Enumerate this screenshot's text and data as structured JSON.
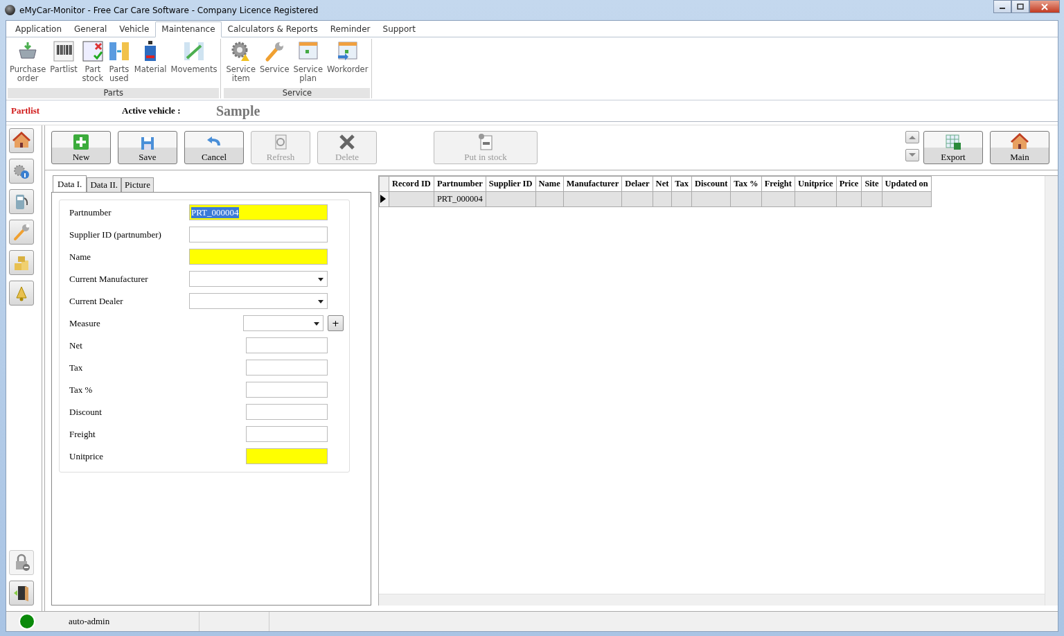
{
  "window": {
    "title": "eMyCar-Monitor - Free Car Care Software - Company Licence Registered"
  },
  "menu_tabs": [
    {
      "label": "Application",
      "selected": false
    },
    {
      "label": "General",
      "selected": false
    },
    {
      "label": "Vehicle",
      "selected": false
    },
    {
      "label": "Maintenance",
      "selected": true
    },
    {
      "label": "Calculators & Reports",
      "selected": false
    },
    {
      "label": "Reminder",
      "selected": false
    },
    {
      "label": "Support",
      "selected": false
    }
  ],
  "ribbon": {
    "groups": [
      {
        "label": "Parts",
        "items": [
          {
            "label": "Purchase\norder"
          },
          {
            "label": "Partlist"
          },
          {
            "label": "Part\nstock"
          },
          {
            "label": "Parts\nused"
          },
          {
            "label": "Material"
          },
          {
            "label": "Movements"
          }
        ]
      },
      {
        "label": "Service",
        "items": [
          {
            "label": "Service\nitem"
          },
          {
            "label": "Service"
          },
          {
            "label": "Service\nplan"
          },
          {
            "label": "Workorder"
          }
        ]
      }
    ]
  },
  "header": {
    "module": "Partlist",
    "active_vehicle_label": "Active vehicle :",
    "vehicle": "Sample"
  },
  "toolbar": {
    "buttons": [
      {
        "label": "New",
        "disabled": false
      },
      {
        "label": "Save",
        "disabled": false
      },
      {
        "label": "Cancel",
        "disabled": false
      },
      {
        "label": "Refresh",
        "disabled": true
      },
      {
        "label": "Delete",
        "disabled": true
      }
    ],
    "stock_button": {
      "label": "Put in stock",
      "disabled": true
    },
    "right_buttons": [
      {
        "label": "Export",
        "disabled": false
      },
      {
        "label": "Main",
        "disabled": false
      }
    ]
  },
  "form": {
    "tabs": [
      {
        "label": "Data I.",
        "selected": true
      },
      {
        "label": "Data II.",
        "selected": false
      },
      {
        "label": "Picture",
        "selected": false
      }
    ],
    "fields": [
      {
        "label": "Partnumber",
        "kind": "text",
        "required": true,
        "value": "PRT_000004",
        "text_selected": true
      },
      {
        "label": "Supplier ID (partnumber)",
        "kind": "text",
        "required": false
      },
      {
        "label": "Name",
        "kind": "text",
        "required": true
      },
      {
        "label": "Current Manufacturer",
        "kind": "combo",
        "required": false
      },
      {
        "label": "Current Dealer",
        "kind": "combo",
        "required": false
      },
      {
        "label": "Measure",
        "kind": "unit-combo",
        "required": false,
        "add_button": "+"
      },
      {
        "label": "Net",
        "kind": "amount",
        "required": false
      },
      {
        "label": "Tax",
        "kind": "amount",
        "required": false
      },
      {
        "label": "Tax %",
        "kind": "amount",
        "required": false
      },
      {
        "label": "Discount",
        "kind": "amount",
        "required": false
      },
      {
        "label": "Freight",
        "kind": "amount",
        "required": false
      },
      {
        "label": "Unitprice",
        "kind": "amount",
        "required": true
      }
    ]
  },
  "grid": {
    "columns": [
      "Record ID",
      "Partnumber",
      "Supplier ID",
      "Name",
      "Manufacturer",
      "Delaer",
      "Net",
      "Tax",
      "Discount",
      "Tax %",
      "Freight",
      "Unitprice",
      "Price",
      "Site",
      "Updated on"
    ],
    "rows": [
      {
        "selected": true,
        "cells": [
          null,
          "PRT_000004",
          null,
          null,
          null,
          null,
          null,
          null,
          null,
          null,
          null,
          null,
          null,
          null,
          null
        ]
      }
    ]
  },
  "status_bar": {
    "connected": true,
    "user": "auto-admin"
  }
}
